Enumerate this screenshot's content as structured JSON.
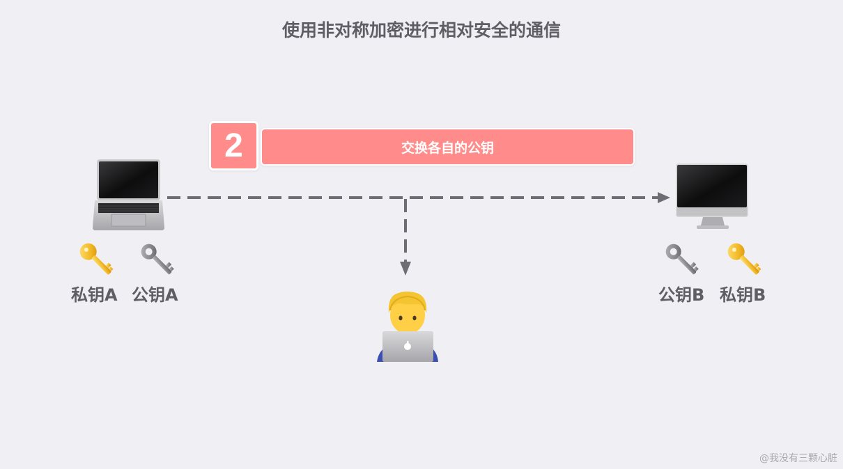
{
  "title": "使用非对称加密进行相对安全的通信",
  "step": {
    "number": "2",
    "label": "交换各自的公钥"
  },
  "left": {
    "device": "laptop-icon",
    "private_key_label": "私钥A",
    "public_key_label": "公钥A"
  },
  "right": {
    "device": "desktop-icon",
    "public_key_label": "公钥B",
    "private_key_label": "私钥B"
  },
  "middle": {
    "actor": "eavesdropper-icon"
  },
  "watermark": "@我没有三颗心脏",
  "colors": {
    "background": "#f0eff4",
    "step_accent": "#ff8b8b",
    "arrow": "#6e6d73",
    "text": "#5e5e64"
  }
}
